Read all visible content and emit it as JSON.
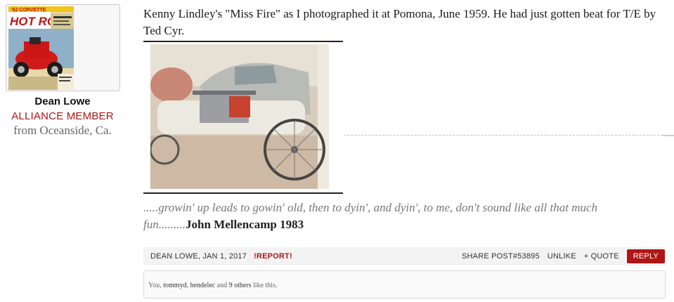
{
  "user": {
    "avatar_icon": "magazine-cover-avatar",
    "avatar_magazine_title": "HOT ROD",
    "avatar_cover_headline": "'62 CORVETTE",
    "name": "Dean Lowe",
    "title": "ALLIANCE MEMBER",
    "location": "from Oceanside, Ca."
  },
  "post": {
    "text": "Kenny Lindley's \"Miss Fire\" as I photographed it at Pomona, June 1959. He had just gotten beat for T/E by Ted Cyr.",
    "photo_icon": "dragster-photo"
  },
  "signature": {
    "quote": ".....growin' up leads to gowin' old, then to dyin', and dyin', to me, don't sound like all that much fun.........",
    "author": "John Mellencamp 1983"
  },
  "footer": {
    "author_date": "DEAN LOWE, JAN 1, 2017",
    "report": "!REPORT!",
    "share": "SHARE POST#53895",
    "unlike": "UNLIKE",
    "quote": "+ QUOTE",
    "reply": "REPLY"
  },
  "likes": {
    "prefix": "You, ",
    "user1": "tommyd",
    "sep": ", ",
    "user2": "hendelec",
    "and": " and ",
    "others": "9 others",
    "suffix": " like this."
  },
  "colors": {
    "accent_red": "#b01616",
    "footer_bg": "#f3f3f3"
  }
}
